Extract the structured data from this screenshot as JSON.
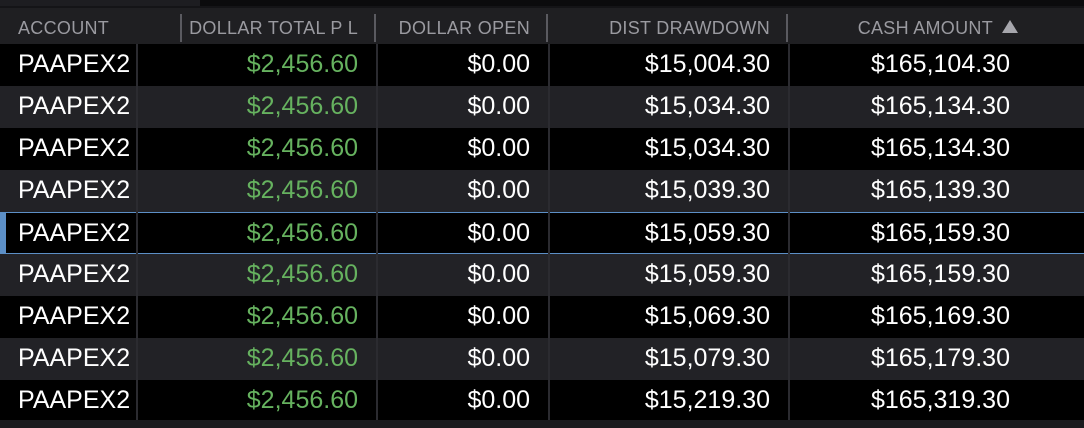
{
  "columns": {
    "account": "ACCOUNT",
    "dollar_total_pl": "DOLLAR TOTAL P L",
    "dollar_open": "DOLLAR OPEN",
    "dist_drawdown": "DIST DRAWDOWN",
    "cash_amount": "CASH AMOUNT"
  },
  "sort": {
    "column": "cash_amount",
    "direction": "ascending",
    "icon": "sort-ascending-icon"
  },
  "colors": {
    "profit_green": "#66b25f",
    "selection_blue": "#5c8fc6",
    "header_text": "#9a9aa0"
  },
  "rows": [
    {
      "account": "PAAPEX2",
      "pl": "$2,456.60",
      "open": "$0.00",
      "drawdown": "$15,004.30",
      "cash": "$165,104.30"
    },
    {
      "account": "PAAPEX2",
      "pl": "$2,456.60",
      "open": "$0.00",
      "drawdown": "$15,034.30",
      "cash": "$165,134.30"
    },
    {
      "account": "PAAPEX2",
      "pl": "$2,456.60",
      "open": "$0.00",
      "drawdown": "$15,034.30",
      "cash": "$165,134.30"
    },
    {
      "account": "PAAPEX2",
      "pl": "$2,456.60",
      "open": "$0.00",
      "drawdown": "$15,039.30",
      "cash": "$165,139.30"
    },
    {
      "account": "PAAPEX2",
      "pl": "$2,456.60",
      "open": "$0.00",
      "drawdown": "$15,059.30",
      "cash": "$165,159.30"
    },
    {
      "account": "PAAPEX2",
      "pl": "$2,456.60",
      "open": "$0.00",
      "drawdown": "$15,059.30",
      "cash": "$165,159.30"
    },
    {
      "account": "PAAPEX2",
      "pl": "$2,456.60",
      "open": "$0.00",
      "drawdown": "$15,069.30",
      "cash": "$165,169.30"
    },
    {
      "account": "PAAPEX2",
      "pl": "$2,456.60",
      "open": "$0.00",
      "drawdown": "$15,079.30",
      "cash": "$165,179.30"
    },
    {
      "account": "PAAPEX2",
      "pl": "$2,456.60",
      "open": "$0.00",
      "drawdown": "$15,219.30",
      "cash": "$165,319.30"
    }
  ],
  "selected_row": 4
}
